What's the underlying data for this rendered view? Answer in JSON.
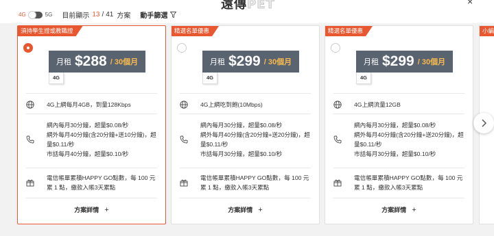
{
  "header": {
    "logo_text": "遠傳",
    "logo_text2": "PET",
    "close_icon": "×"
  },
  "filters": {
    "toggle_left": "4G",
    "toggle_right": "5G",
    "count_label": "目前顯示",
    "count_current": "13",
    "count_sep": "/",
    "count_total": "41",
    "count_unit": "方案",
    "manual_filter": "動手篩選"
  },
  "plans": [
    {
      "tag": "須持學生證或教職證",
      "selected": true,
      "price_label": "月租",
      "price": "$288",
      "period": "/ 30個月",
      "network": "4G",
      "data": "4G上網每月4GB，到量128Kbps",
      "voice": "網內每月30分鐘，超量$0.08/秒\n網外每月40分鐘(含20分鐘+送10分鐘)，超量$0.11/秒\n市話每月40分鐘，超量$0.10/秒",
      "points": "電信帳單累積HAPPY GO點數，每 100 元累 1 點，繳款入帳3天累點",
      "details": "方案詳情"
    },
    {
      "tag": "精選名單優惠",
      "selected": false,
      "price_label": "月租",
      "price": "$299",
      "period": "/ 30個月",
      "network": "4G",
      "data": "4G上網吃到飽(10Mbps)",
      "voice": "網內每月30分鐘，超量$0.08/秒\n網外每月40分鐘(含20分鐘+送20分鐘)，超量$0.11/秒\n市話每月30分鐘，超量$0.10/秒",
      "points": "電信帳單累積HAPPY GO點數，每 100 元累 1 點，繳款入帳3天累點",
      "details": "方案詳情"
    },
    {
      "tag": "精選名單優惠",
      "selected": false,
      "price_label": "月租",
      "price": "$299",
      "period": "/ 30個月",
      "network": "4G",
      "data": "4G上網流量12GB",
      "voice": "網內每月30分鐘，超量$0.08/秒\n網外每月40分鐘(含20分鐘+送20分鐘)，超量$0.11/秒\n市話每月30分鐘，超量$0.10/秒",
      "points": "電信帳單累積HAPPY GO點數，每 100 元累 1 點，繳款入帳3天累點",
      "details": "方案詳情"
    }
  ],
  "partial_card": {
    "tag": "小編"
  },
  "colors": {
    "accent": "#e8572f",
    "price_bg": "#5a6370",
    "period": "#f5b94e"
  }
}
